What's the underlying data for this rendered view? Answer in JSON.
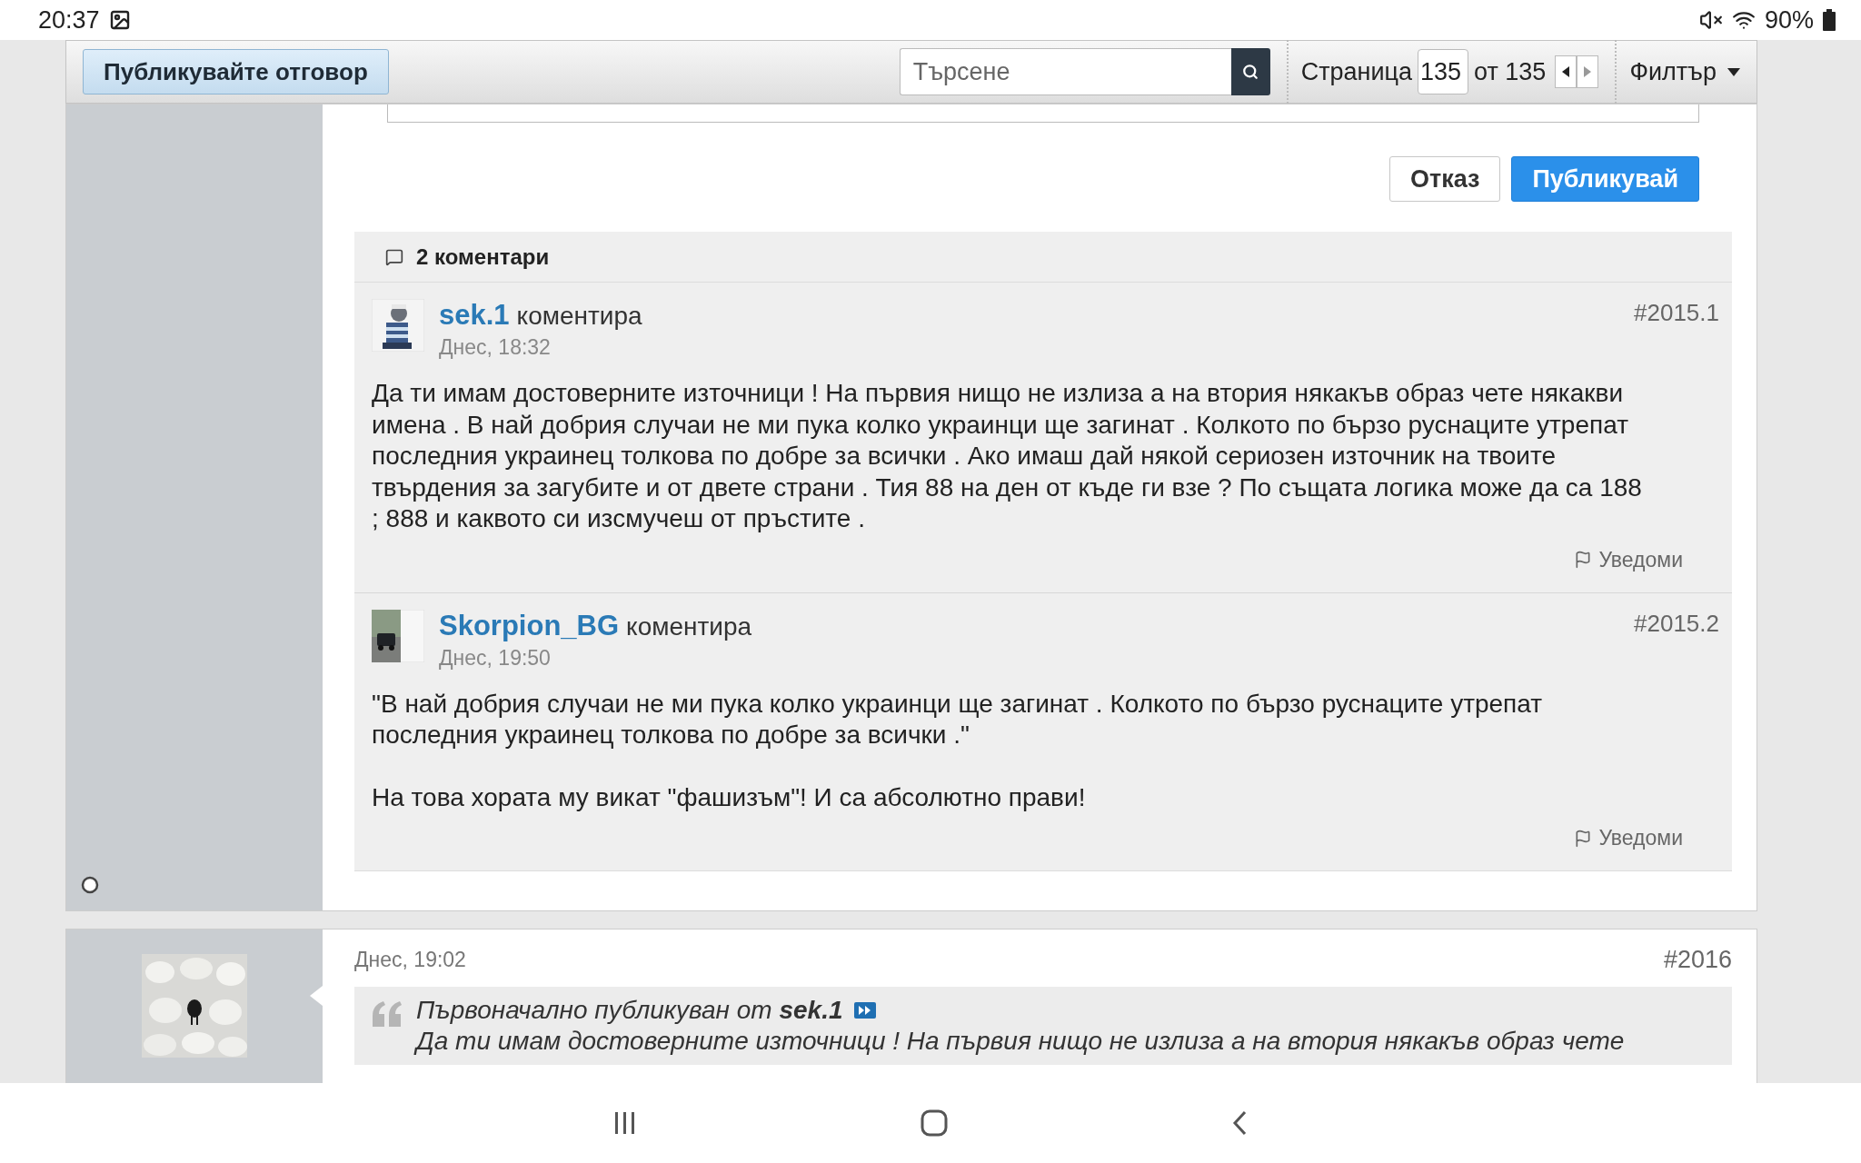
{
  "status_bar": {
    "time": "20:37",
    "battery": "90%"
  },
  "toolbar": {
    "reply_button": "Публикувайте отговор",
    "search": {
      "placeholder": "Търсене"
    },
    "page_label": "Страница",
    "page_value": "135",
    "page_total": "от 135",
    "filter": "Филтър"
  },
  "reply_form": {
    "cancel": "Отказ",
    "publish": "Публикувай"
  },
  "comments": {
    "header": "2 коментари",
    "items": [
      {
        "author": "sek.1",
        "action": "коментира",
        "date": "Днес, 18:32",
        "number": "#2015.1",
        "paragraphs": [
          "Да ти имам достоверните източници ! На първия нищо не излиза а на втория някакъв образ чете някакви имена . В най добрия случаи не ми пука колко украинци ще загинат . Колкото по бързо руснаците утрепат последния украинец толкова по добре за всички . Ако имаш дай някой сериозен източник на твоите твърдения за загубите и от двете страни . Тия 88 на ден от къде ги взе ? По същата логика може да са 188 ; 888 и каквото си изсмучеш от пръстите ."
        ],
        "report": "Уведоми"
      },
      {
        "author": "Skorpion_BG",
        "action": "коментира",
        "date": "Днес, 19:50",
        "number": "#2015.2",
        "paragraphs": [
          "\"В най добрия случаи не ми пука колко украинци ще загинат . Колкото по бързо руснаците утрепат последния украинец толкова по добре за всички .\"",
          "На това хората му викат \"фашизъм\"! И са абсолютно прави!"
        ],
        "report": "Уведоми"
      }
    ]
  },
  "next_post": {
    "date": "Днес, 19:02",
    "number": "#2016",
    "quote": {
      "label": "Първоначално публикуван от **sek.1**",
      "text": "Да ти имам достоверните източници ! На първия нищо не излиза а на втория някакъв образ чете"
    }
  }
}
